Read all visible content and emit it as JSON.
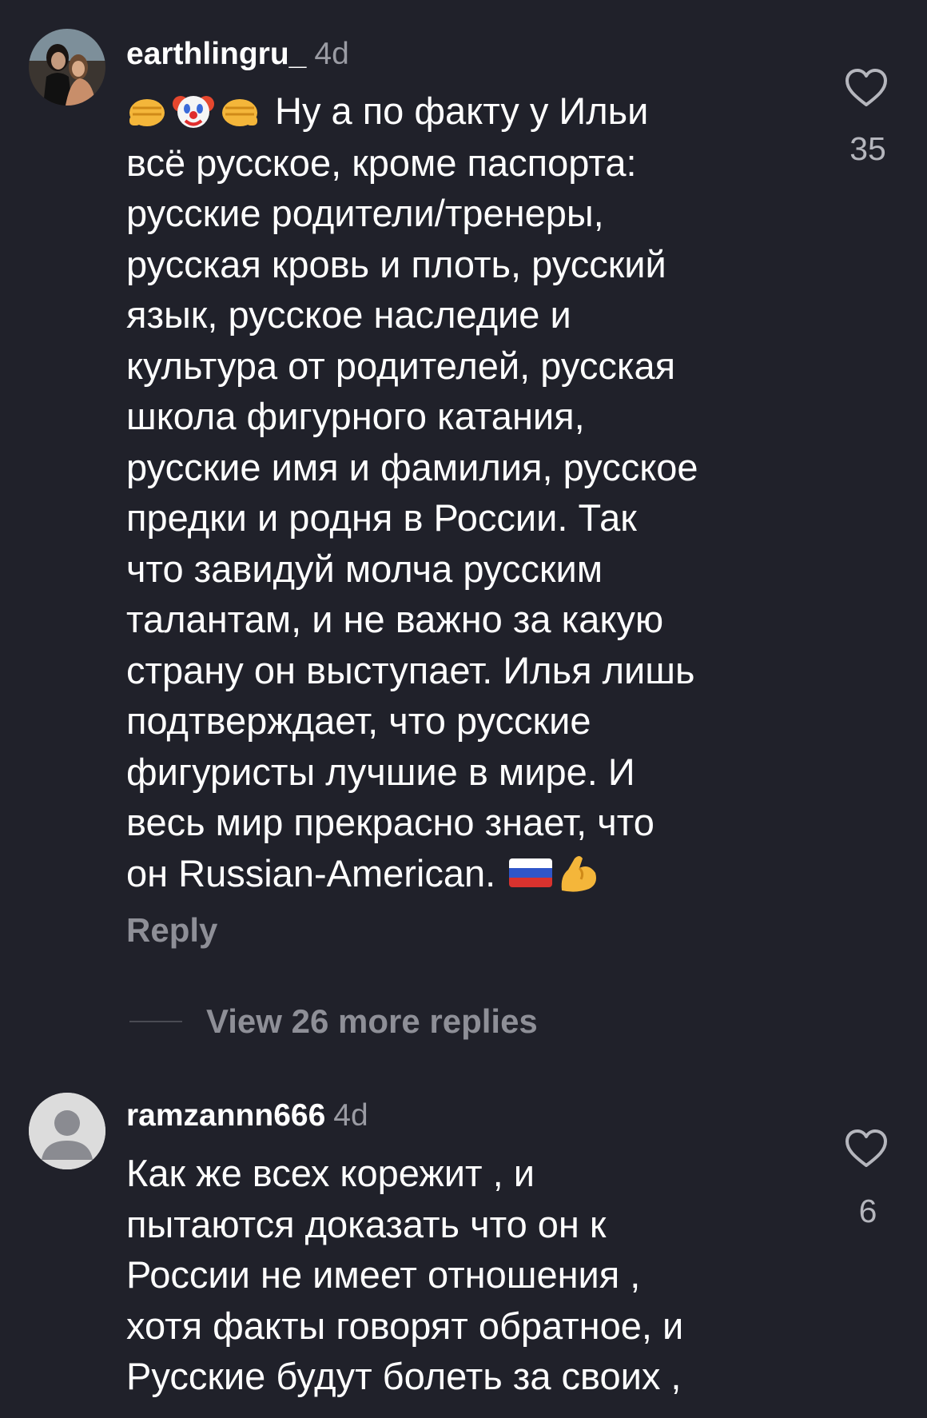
{
  "comments": [
    {
      "username": "earthlingru_",
      "time": "4d",
      "text_line_1": "Ну а по факту у Ильи",
      "text_rest": [
        "всё русское, кроме паспорта:",
        "русские родители/тренеры,",
        "русская кровь и плоть, русский",
        "язык, русское наследие и",
        "культура от родителей, русская",
        "школа фигурного катания,",
        "русские имя и фамилия, русское",
        "предки и родня в России. Так",
        "что завидуй молча русским",
        "талантам, и не важно за какую",
        "страну он выступает. Илья лишь",
        "подтверждает, что русские",
        "фигуристы лучшие в мире. И",
        "весь мир прекрасно знает, что",
        "он Russian-American."
      ],
      "emojis_start": [
        "fist-emoji",
        "clown-emoji",
        "fist-emoji"
      ],
      "emojis_end": [
        "russia-flag-emoji",
        "flexed-biceps-emoji"
      ],
      "likes": "35",
      "reply_label": "Reply",
      "view_replies_label": "View 26 more replies"
    },
    {
      "username": "ramzannn666",
      "time": "4d",
      "text_lines": [
        "Как же всех корежит , и",
        "пытаются доказать что он к",
        "России не имеет отношения ,",
        "хотя факты говорят обратное, и",
        "Русские будут болеть за своих ,"
      ],
      "likes": "6"
    }
  ],
  "colors": {
    "background": "#20212a",
    "text": "#ffffff",
    "muted": "#8e8f97",
    "timestamp": "#9a9ba3"
  }
}
